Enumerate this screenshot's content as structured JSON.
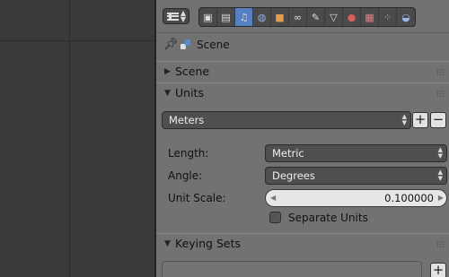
{
  "context": {
    "label": "Scene"
  },
  "header": {
    "tabs": [
      {
        "name": "render-camera-icon",
        "glyph": "▣"
      },
      {
        "name": "render-layers-icon",
        "glyph": "▤"
      },
      {
        "name": "scene-icon",
        "glyph": "♫"
      },
      {
        "name": "world-icon",
        "glyph": "◍"
      },
      {
        "name": "object-icon",
        "glyph": "■"
      },
      {
        "name": "constraints-icon",
        "glyph": "∞"
      },
      {
        "name": "modifiers-icon",
        "glyph": "✎"
      },
      {
        "name": "object-data-icon",
        "glyph": "▽"
      },
      {
        "name": "material-icon",
        "glyph": "●"
      },
      {
        "name": "texture-icon",
        "glyph": "▦"
      },
      {
        "name": "particles-icon",
        "glyph": "⁘"
      },
      {
        "name": "physics-icon",
        "glyph": "◒"
      }
    ]
  },
  "panels": {
    "scene": {
      "title": "Scene"
    },
    "units": {
      "title": "Units",
      "preset": "Meters",
      "length_label": "Length:",
      "length_value": "Metric",
      "angle_label": "Angle:",
      "angle_value": "Degrees",
      "unit_scale_label": "Unit Scale:",
      "unit_scale_value": "0.100000",
      "separate_units_label": "Separate Units"
    },
    "keying_sets": {
      "title": "Keying Sets"
    }
  },
  "colors": {
    "active_tab": "#5680c2",
    "panel_bg": "#727272",
    "viewport_bg": "#3a3a3a"
  }
}
